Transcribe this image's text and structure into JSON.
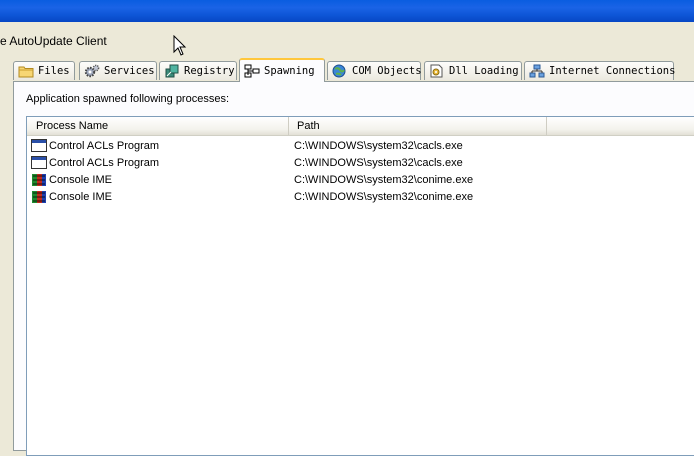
{
  "window": {
    "subtitle": "e AutoUpdate Client"
  },
  "tabs": [
    {
      "label": "Files",
      "icon": "folder-icon"
    },
    {
      "label": "Services",
      "icon": "gears-icon"
    },
    {
      "label": "Registry",
      "icon": "registry-icon"
    },
    {
      "label": "Spawning",
      "icon": "network-tree-icon",
      "active": true
    },
    {
      "label": "COM Objects",
      "icon": "globe-icon"
    },
    {
      "label": "Dll Loading",
      "icon": "dll-icon"
    },
    {
      "label": "Internet Connections",
      "icon": "network-icon"
    }
  ],
  "panel": {
    "caption": "Application spawned following processes:"
  },
  "list": {
    "columns": [
      "Process Name",
      "Path"
    ],
    "rows": [
      {
        "name": "Control ACLs Program",
        "path": "C:\\WINDOWS\\system32\\cacls.exe",
        "icon": "window-app-icon"
      },
      {
        "name": "Control ACLs Program",
        "path": "C:\\WINDOWS\\system32\\cacls.exe",
        "icon": "window-app-icon"
      },
      {
        "name": "Console IME",
        "path": "C:\\WINDOWS\\system32\\conime.exe",
        "icon": "ime-icon"
      },
      {
        "name": "Console IME",
        "path": "C:\\WINDOWS\\system32\\conime.exe",
        "icon": "ime-icon"
      }
    ]
  },
  "colors": {
    "titlebar": "#0a5de0",
    "background": "#ece9d8",
    "active_tab_highlight": "#ffc73c",
    "list_border": "#7f9db9"
  }
}
